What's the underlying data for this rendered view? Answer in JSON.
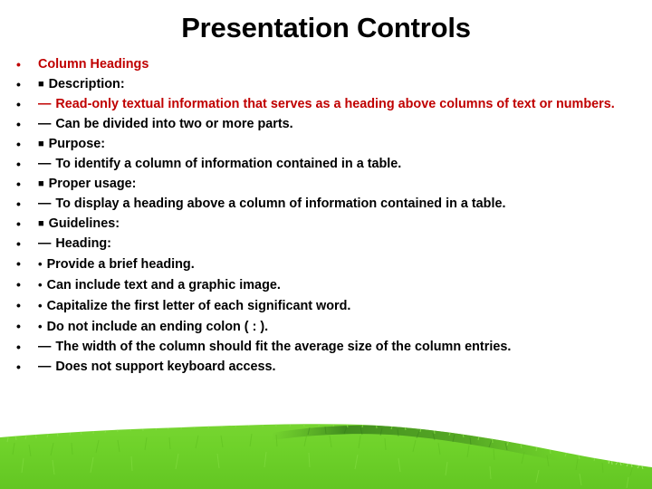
{
  "slide": {
    "title": "Presentation Controls",
    "background_color": "#FFFFFF",
    "accent_red": "#C00000",
    "text_black": "#000000",
    "grass_green": "#6FD22A",
    "grass_dark_green": "#3F8A1E"
  },
  "bullets": [
    {
      "marker": "•",
      "marker_color": "red",
      "sub_marker": "",
      "sub_marker_kind": "none",
      "text": "Column Headings",
      "text_color": "red"
    },
    {
      "marker": "•",
      "marker_color": "black",
      "sub_marker": "■",
      "sub_marker_kind": "square",
      "text": "Description:",
      "text_color": "black"
    },
    {
      "marker": "•",
      "marker_color": "black",
      "sub_marker": "—",
      "sub_marker_kind": "dash",
      "text": "Read-only textual information that serves as a heading above columns of text or numbers.",
      "text_color": "red"
    },
    {
      "marker": "•",
      "marker_color": "black",
      "sub_marker": "—",
      "sub_marker_kind": "dash",
      "text": "Can be divided into two or more parts.",
      "text_color": "black"
    },
    {
      "marker": "•",
      "marker_color": "black",
      "sub_marker": "■",
      "sub_marker_kind": "square",
      "text": "Purpose:",
      "text_color": "black"
    },
    {
      "marker": "•",
      "marker_color": "black",
      "sub_marker": "—",
      "sub_marker_kind": "dash",
      "text": "To identify a column of information contained in a table.",
      "text_color": "black"
    },
    {
      "marker": "•",
      "marker_color": "black",
      "sub_marker": "■",
      "sub_marker_kind": "square",
      "text": "Proper usage:",
      "text_color": "black"
    },
    {
      "marker": "•",
      "marker_color": "black",
      "sub_marker": "—",
      "sub_marker_kind": "dash",
      "text": "To display a heading above a column of information contained in a table.",
      "text_color": "black"
    },
    {
      "marker": "•",
      "marker_color": "black",
      "sub_marker": "■",
      "sub_marker_kind": "square",
      "text": "Guidelines:",
      "text_color": "black"
    },
    {
      "marker": "•",
      "marker_color": "black",
      "sub_marker": "—",
      "sub_marker_kind": "dash",
      "text": "Heading:",
      "text_color": "black"
    },
    {
      "marker": "•",
      "marker_color": "black",
      "sub_marker": "•",
      "sub_marker_kind": "dot",
      "text": "Provide a brief heading.",
      "text_color": "black"
    },
    {
      "marker": "•",
      "marker_color": "black",
      "sub_marker": "•",
      "sub_marker_kind": "dot",
      "text": "Can include text and a graphic image.",
      "text_color": "black"
    },
    {
      "marker": "•",
      "marker_color": "black",
      "sub_marker": "•",
      "sub_marker_kind": "dot",
      "text": "Capitalize the first letter of each significant word.",
      "text_color": "black"
    },
    {
      "marker": "•",
      "marker_color": "black",
      "sub_marker": "•",
      "sub_marker_kind": "dot",
      "text": "Do not include an ending colon ( : ).",
      "text_color": "black"
    },
    {
      "marker": "•",
      "marker_color": "black",
      "sub_marker": "—",
      "sub_marker_kind": "dash",
      "text": "The width of the column should fit the average size of the column entries.",
      "text_color": "black"
    },
    {
      "marker": "•",
      "marker_color": "black",
      "sub_marker": "—",
      "sub_marker_kind": "dash",
      "text": "Does not support keyboard access.",
      "text_color": "black"
    }
  ]
}
